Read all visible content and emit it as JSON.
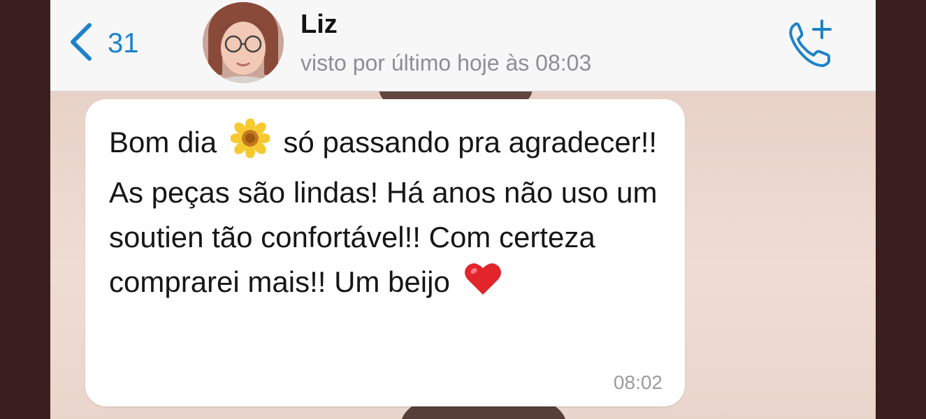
{
  "header": {
    "back_count": "31",
    "contact_name": "Liz",
    "last_seen": "visto por último hoje às 08:03",
    "accent_color": "#1d82c9"
  },
  "message": {
    "part1": "Bom dia",
    "emoji1": "sunflower-emoji",
    "part2": "só passando pra agradecer!! As peças são lindas! Há anos não uso um soutien tão confortável!! Com certeza comprarei mais!! Um beijo",
    "emoji2": "red-heart-emoji",
    "time": "08:02"
  },
  "icons": {
    "back": "chevron-left-icon",
    "call": "add-call-icon"
  }
}
